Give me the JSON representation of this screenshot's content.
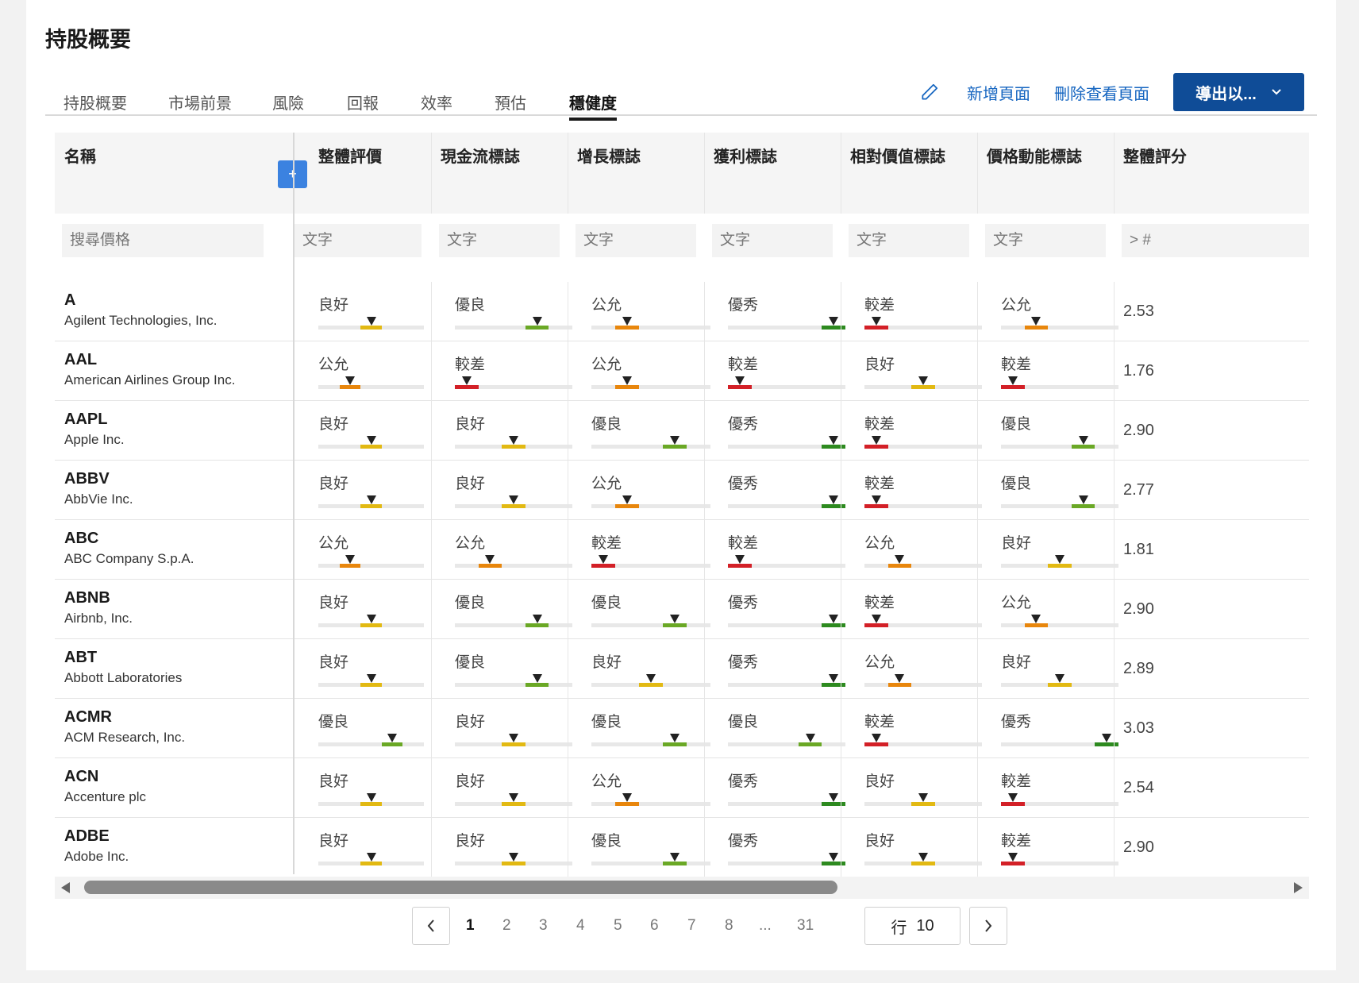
{
  "page_title": "持股概要",
  "tabs": [
    {
      "label": "持股概要",
      "active": false
    },
    {
      "label": "市場前景",
      "active": false
    },
    {
      "label": "風險",
      "active": false
    },
    {
      "label": "回報",
      "active": false
    },
    {
      "label": "效率",
      "active": false
    },
    {
      "label": "預估",
      "active": false
    },
    {
      "label": "穩健度",
      "active": true
    }
  ],
  "actions": {
    "edit_icon": "pencil-icon",
    "add_page": "新增頁面",
    "delete_page": "刪除查看頁面",
    "export": "導出以..."
  },
  "colors": {
    "accent": "#1565c0",
    "export_bg": "#0f4c97",
    "add_btn": "#3b82e0",
    "poor": "#d32027",
    "fair": "#e8860c",
    "good": "#e2b912",
    "very_good": "#6aa825",
    "excellent": "#2d8a1f"
  },
  "columns": {
    "name": "名稱",
    "add_column_label": "+",
    "grades": [
      "整體評價",
      "現金流標誌",
      "增長標誌",
      "獲利標誌",
      "相對價值標誌",
      "價格動能標誌"
    ],
    "score": "整體評分"
  },
  "filters": {
    "name_placeholder": "搜尋價格",
    "text_placeholder": "文字",
    "score_placeholder": "> #"
  },
  "grade_scale": {
    "較差": 1,
    "公允": 2,
    "良好": 3,
    "優良": 4,
    "優秀": 5
  },
  "rows": [
    {
      "ticker": "A",
      "company": "Agilent Technologies, Inc.",
      "grades": [
        "良好",
        "優良",
        "公允",
        "優秀",
        "較差",
        "公允"
      ],
      "score": "2.53"
    },
    {
      "ticker": "AAL",
      "company": "American Airlines Group Inc.",
      "grades": [
        "公允",
        "較差",
        "公允",
        "較差",
        "良好",
        "較差"
      ],
      "score": "1.76"
    },
    {
      "ticker": "AAPL",
      "company": "Apple Inc.",
      "grades": [
        "良好",
        "良好",
        "優良",
        "優秀",
        "較差",
        "優良"
      ],
      "score": "2.90"
    },
    {
      "ticker": "ABBV",
      "company": "AbbVie Inc.",
      "grades": [
        "良好",
        "良好",
        "公允",
        "優秀",
        "較差",
        "優良"
      ],
      "score": "2.77"
    },
    {
      "ticker": "ABC",
      "company": "ABC Company S.p.A.",
      "grades": [
        "公允",
        "公允",
        "較差",
        "較差",
        "公允",
        "良好"
      ],
      "score": "1.81"
    },
    {
      "ticker": "ABNB",
      "company": "Airbnb, Inc.",
      "grades": [
        "良好",
        "優良",
        "優良",
        "優秀",
        "較差",
        "公允"
      ],
      "score": "2.90"
    },
    {
      "ticker": "ABT",
      "company": "Abbott Laboratories",
      "grades": [
        "良好",
        "優良",
        "良好",
        "優秀",
        "公允",
        "良好"
      ],
      "score": "2.89"
    },
    {
      "ticker": "ACMR",
      "company": "ACM Research, Inc.",
      "grades": [
        "優良",
        "良好",
        "優良",
        "優良",
        "較差",
        "優秀"
      ],
      "score": "3.03"
    },
    {
      "ticker": "ACN",
      "company": "Accenture plc",
      "grades": [
        "良好",
        "良好",
        "公允",
        "優秀",
        "良好",
        "較差"
      ],
      "score": "2.54"
    },
    {
      "ticker": "ADBE",
      "company": "Adobe Inc.",
      "grades": [
        "良好",
        "良好",
        "優良",
        "優秀",
        "良好",
        "較差"
      ],
      "score": "2.90"
    }
  ],
  "pagination": {
    "pages": [
      "1",
      "2",
      "3",
      "4",
      "5",
      "6",
      "7",
      "8",
      "...",
      "31"
    ],
    "current": "1",
    "rows_label": "行",
    "rows_value": "10",
    "prev_icon": "chevron-left-icon",
    "next_icon": "chevron-right-icon"
  }
}
